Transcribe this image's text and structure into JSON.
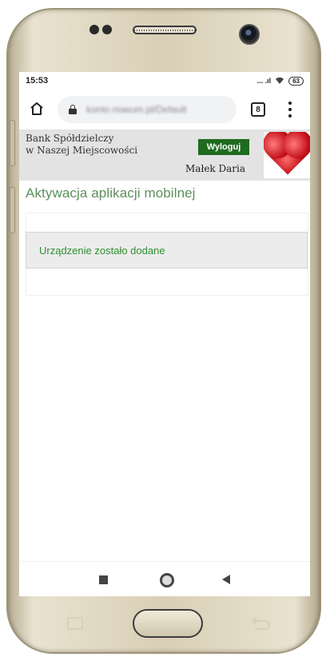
{
  "status_bar": {
    "time": "15:53",
    "signal_text": "... .ıl",
    "battery": "63"
  },
  "browser": {
    "url": "konto.nowum.pl/Default",
    "tabs_count": "8"
  },
  "bank_header": {
    "bank_name_line1": "Bank Spółdzielczy",
    "bank_name_line2": "w Naszej Miejscowości",
    "logout_label": "Wyloguj",
    "user_name": "Małek Daria"
  },
  "page": {
    "title": "Aktywacja aplikacji mobilnej",
    "message": "Urządzenie zostało dodane"
  },
  "colors": {
    "accent_green": "#1f6b1f",
    "title_green": "#5c8f5c",
    "message_green": "#2f8f2f"
  },
  "icons": [
    "home-icon",
    "lock-icon",
    "tabs-icon",
    "menu-icon",
    "wifi-icon",
    "nav-recent-icon",
    "nav-home-icon",
    "nav-back-icon"
  ]
}
